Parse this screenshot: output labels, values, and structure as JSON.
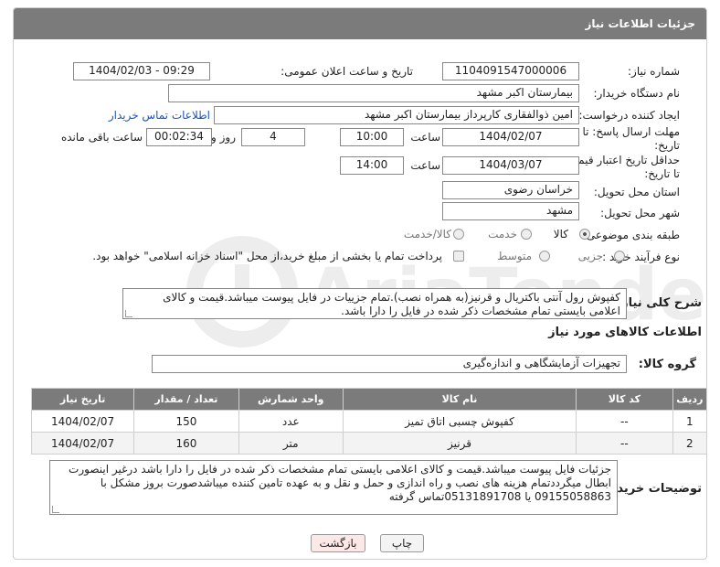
{
  "header": {
    "title": "جزئیات اطلاعات نیاز"
  },
  "form": {
    "need_number_label": "شماره نیاز:",
    "need_number": "1104091547000006",
    "announce_label": "تاریخ و ساعت اعلان عمومی:",
    "announce_value": "1404/02/03 - 09:29",
    "buyer_org_label": "نام دستگاه خریدار:",
    "buyer_org": "بیمارستان اکبر مشهد",
    "creator_label": "ایجاد کننده درخواست:",
    "creator": "امین ذوالفقاری کارپرداز بیمارستان اکبر مشهد",
    "contact_link": "اطلاعات تماس خریدار",
    "deadline_label_1": "مهلت ارسال پاسخ: تا",
    "deadline_label_2": "تاریخ:",
    "deadline_date": "1404/02/07",
    "time_label": "ساعت",
    "deadline_time": "10:00",
    "days_value": "4",
    "days_label": "روز و",
    "remaining_time": "00:02:34",
    "remaining_label": "ساعت باقی مانده",
    "validity_label_1": "حداقل تاریخ اعتبار قیمت:",
    "validity_label_2": "تا تاریخ:",
    "validity_date": "1404/03/07",
    "validity_time_label": "ساعت",
    "validity_time": "14:00",
    "province_label": "استان محل تحویل:",
    "province": "خراسان رضوی",
    "city_label": "شهر محل تحویل:",
    "city": "مشهد",
    "category_label": "طبقه بندی موضوعی:",
    "category_options": [
      "کالا",
      "خدمت",
      "کالا/خدمت"
    ],
    "purchase_type_label": "نوع فرآیند خرید :",
    "purchase_options": [
      "جزیی",
      "متوسط"
    ],
    "payment_note": "پرداخت تمام یا بخشی از مبلغ خرید،از محل \"اسناد خزانه اسلامی\" خواهد بود.",
    "general_desc_label": "شرح کلی نیاز:",
    "general_desc": "کفپوش  رول آنتی باکتریال  و قرنیز(به همراه نصب).تمام جزییات در فایل پیوست میباشد.قیمت و کالای اعلامی بایستی تمام مشخصات ذکر شده در فایل را دارا باشد."
  },
  "goods": {
    "section_title": "اطلاعات کالاهای مورد نیاز",
    "group_label": "گروه کالا:",
    "group_value": "تجهیزات آزمایشگاهی و اندازه‌گیری",
    "columns": [
      "ردیف",
      "کد کالا",
      "نام کالا",
      "واحد شمارش",
      "تعداد / مقدار",
      "تاریخ نیاز"
    ],
    "rows": [
      [
        "1",
        "--",
        "کفپوش چسبی اتاق تمیز",
        "عدد",
        "150",
        "1404/02/07"
      ],
      [
        "2",
        "--",
        "قرنیز",
        "متر",
        "160",
        "1404/02/07"
      ]
    ]
  },
  "buyer_notes": {
    "label": "توضیحات خریدار:",
    "text": "جزئیات فایل پیوست میباشد.قیمت و کالای اعلامی بایستی تمام مشخصات ذکر شده در فایل را دارا باشد درغیر اینصورت ابطال میگرددتمام هزینه های نصب و راه اندازی و حمل و نقل و به عهده تامین کننده میباشدصورت بروز مشکل با 09155058863 یا 05131891708تماس گرفته"
  },
  "buttons": {
    "print": "چاپ",
    "back": "بازگشت"
  },
  "watermark_text": "AriaTender.neT"
}
